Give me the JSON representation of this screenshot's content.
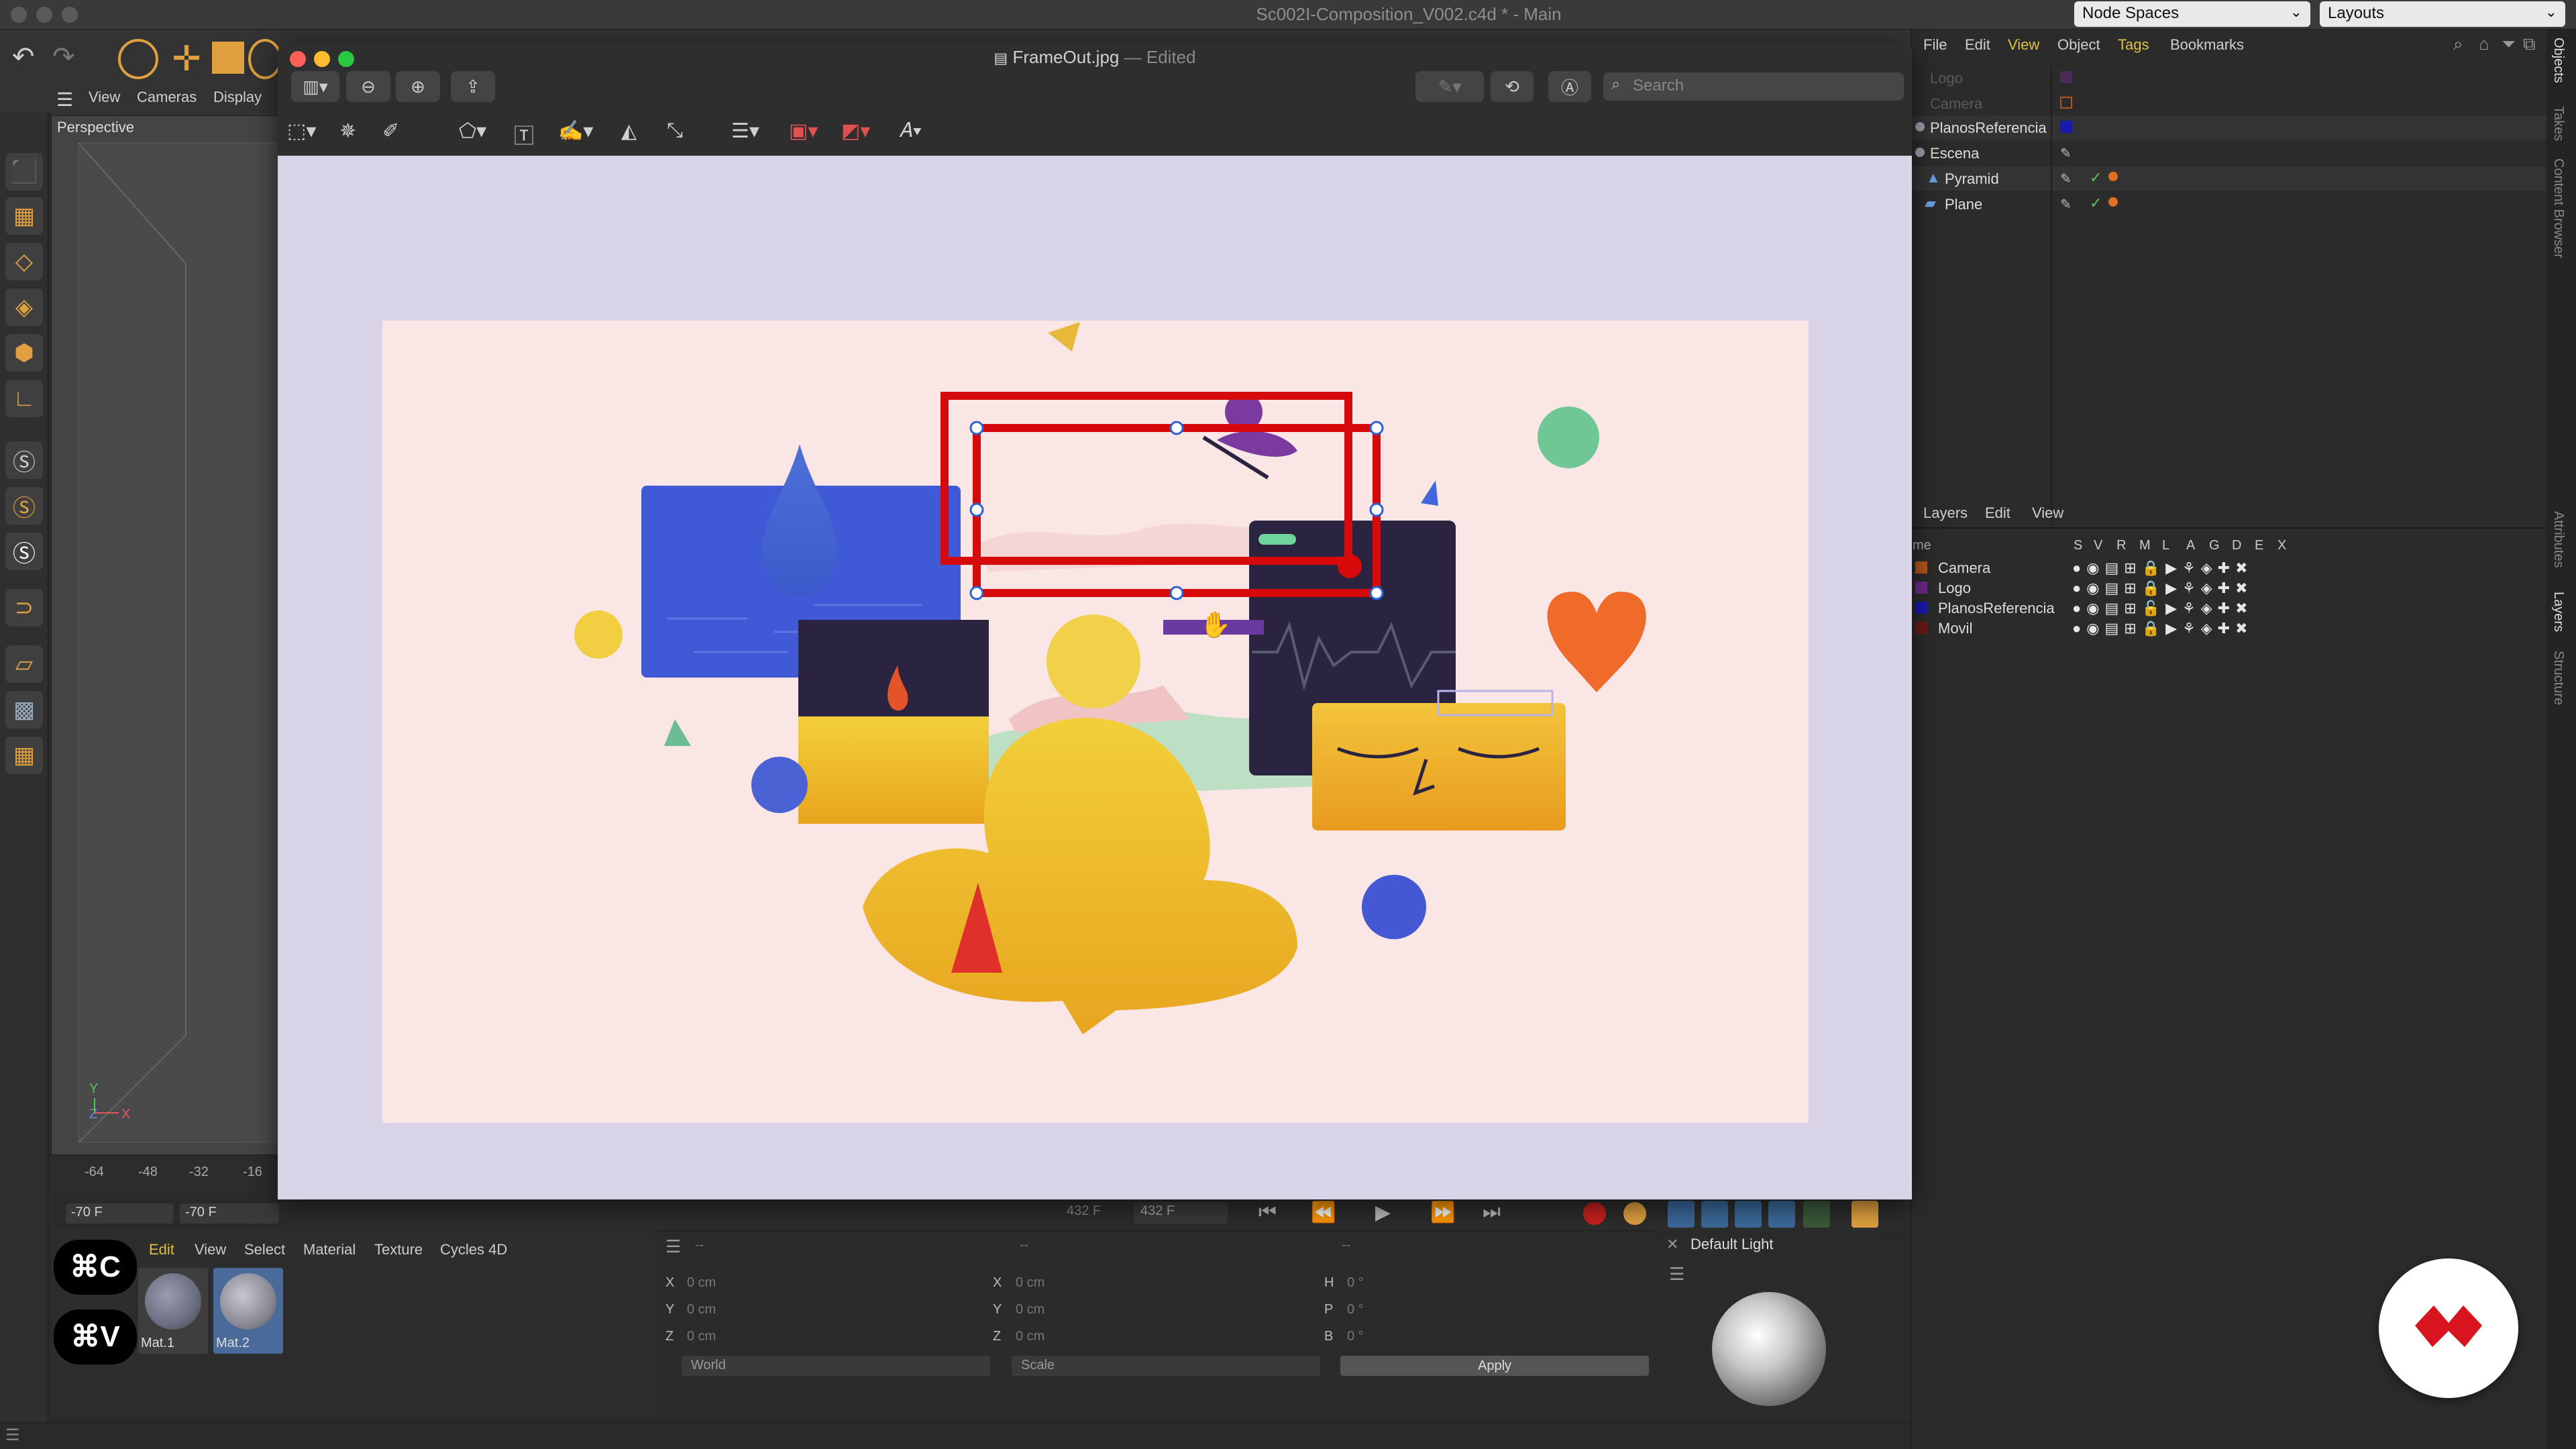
{
  "app": {
    "window_title": "Sc002I-Composition_V002.c4d * - Main",
    "node_spaces": "Node Spaces",
    "layouts": "Layouts"
  },
  "viewport": {
    "menu": [
      "View",
      "Cameras",
      "Display"
    ],
    "label": "Perspective",
    "ruler_ticks": [
      "-64",
      "-48",
      "-32",
      "-16"
    ],
    "frame_start": "-70 F",
    "frame_current": "-70 F",
    "frame_end_a": "432 F",
    "frame_end_b": "432 F"
  },
  "preview": {
    "file_name": "FrameOut.jpg",
    "edited": "— Edited",
    "search_placeholder": "Search"
  },
  "materials": {
    "menu": [
      "Edit",
      "View",
      "Select",
      "Material",
      "Texture",
      "Cycles 4D"
    ],
    "items": [
      "Mat.1",
      "Mat.2"
    ]
  },
  "shortcuts": {
    "copy": "⌘C",
    "paste": "⌘V"
  },
  "coordinates": {
    "headers": [
      "--",
      "--",
      "--"
    ],
    "rows": [
      {
        "a": "X",
        "av": "0 cm",
        "b": "X",
        "bv": "0 cm",
        "c": "H",
        "cv": "0 °"
      },
      {
        "a": "Y",
        "av": "0 cm",
        "b": "Y",
        "bv": "0 cm",
        "c": "P",
        "cv": "0 °"
      },
      {
        "a": "Z",
        "av": "0 cm",
        "b": "Z",
        "bv": "0 cm",
        "c": "B",
        "cv": "0 °"
      }
    ],
    "space": "World",
    "mode": "Scale",
    "apply": "Apply"
  },
  "light_panel": {
    "title": "Default Light"
  },
  "objects": {
    "menu": [
      "File",
      "Edit",
      "View",
      "Object",
      "Tags",
      "Bookmarks"
    ],
    "items": [
      {
        "name": "Logo",
        "dim": true
      },
      {
        "name": "Camera",
        "dim": true
      },
      {
        "name": "PlanosReferencia",
        "dim": false
      },
      {
        "name": "Escena",
        "dim": false
      },
      {
        "name": "Pyramid",
        "dim": false
      },
      {
        "name": "Plane",
        "dim": false
      }
    ]
  },
  "layers": {
    "menu": [
      "Layers",
      "Edit",
      "View"
    ],
    "col_name": "me",
    "cols": [
      "S",
      "V",
      "R",
      "M",
      "L",
      "A",
      "G",
      "D",
      "E",
      "X"
    ],
    "items": [
      {
        "name": "Camera",
        "color": "#b0551e"
      },
      {
        "name": "Logo",
        "color": "#6a2a8a"
      },
      {
        "name": "PlanosReferencia",
        "color": "#1a1ab0"
      },
      {
        "name": "Movil",
        "color": "#6a1a1a"
      }
    ]
  },
  "side_tabs": [
    "Objects",
    "Takes",
    "Content Browser",
    "Attributes",
    "Layers",
    "Structure"
  ],
  "colors": {
    "selection_red": "#d60a0a",
    "handle_blue": "#2a62d6",
    "accent_orange": "#e0a040",
    "brand_red": "#d8141e"
  }
}
